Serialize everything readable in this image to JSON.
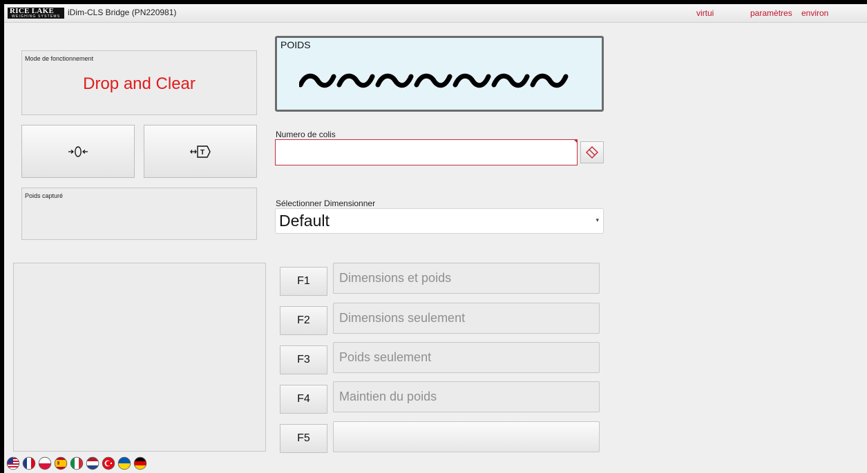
{
  "header": {
    "logo_text": "RICE LAKE",
    "logo_subtext": "WEIGHING SYSTEMS",
    "app_title": "iDim-CLS Bridge (PN220981)",
    "links": [
      "virtui",
      "paramètres",
      "environ"
    ]
  },
  "mode": {
    "label": "Mode de fonctionnement",
    "value": "Drop and Clear"
  },
  "buttons": {
    "zero_icon": "zero-icon",
    "tare_icon": "tare-icon"
  },
  "captured": {
    "label": "Poids capturé"
  },
  "weight": {
    "label": "POIDS",
    "display_icon": "tilde-icon",
    "display_glyph_count": 7
  },
  "colli": {
    "label": "Numero de colis",
    "value": "",
    "clear_icon": "eraser-icon"
  },
  "dimensioner": {
    "label": "Sélectionner Dimensionner",
    "selected": "Default"
  },
  "function_keys": [
    {
      "key": "F1",
      "label": "Dimensions et poids"
    },
    {
      "key": "F2",
      "label": "Dimensions seulement"
    },
    {
      "key": "F3",
      "label": "Poids seulement"
    },
    {
      "key": "F4",
      "label": "Maintien du poids"
    },
    {
      "key": "F5",
      "label": ""
    }
  ],
  "languages": [
    "us-flag-icon",
    "fr-flag-icon",
    "pl-flag-icon",
    "es-flag-icon",
    "it-flag-icon",
    "nl-flag-icon",
    "tr-flag-icon",
    "ua-flag-icon",
    "de-flag-icon"
  ],
  "colors": {
    "accent_red": "#c0132b",
    "mode_red": "#e01b1b",
    "weight_bg": "#e4f4f9"
  }
}
